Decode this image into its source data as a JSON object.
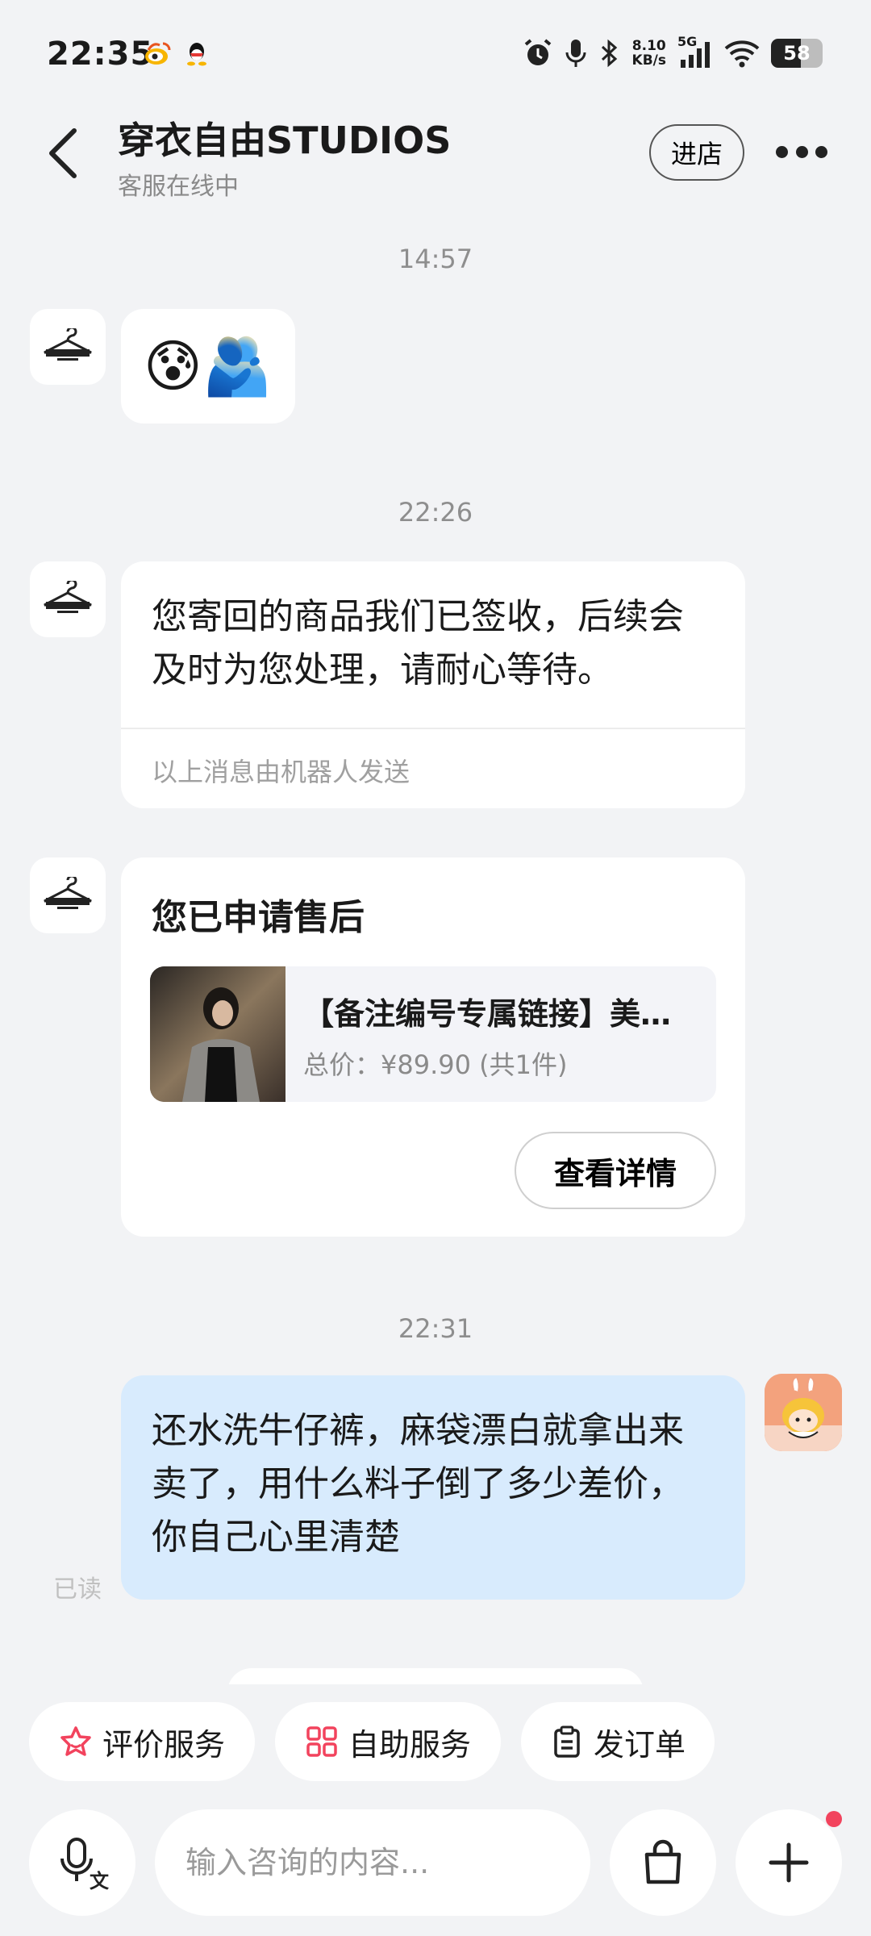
{
  "status_bar": {
    "time": "22:35",
    "net_speed_value": "8.10",
    "net_speed_unit": "KB/s",
    "network_type": "5G",
    "battery": "58",
    "battery_level": 0.58
  },
  "header": {
    "title": "穿衣自由STUDIOS",
    "subtitle": "客服在线中",
    "enter_store": "进店"
  },
  "messages": {
    "ts1": "14:57",
    "emoji": "😰🫂",
    "ts2": "22:26",
    "received_text": "您寄回的商品我们已签收，后续会及时为您处理，请耐心等待。",
    "robot_note": "以上消息由机器人发送",
    "after_sale": {
      "title": "您已申请售后",
      "product_name": "【备注编号专属链接】美…",
      "product_price": "总价：¥89.90 (共1件)",
      "detail_button": "查看详情"
    },
    "ts3": "22:31",
    "sent_text": "还水洗牛仔裤，麻袋漂白就拿出来卖了，用什么料子倒了多少差价，你自己心里清楚",
    "read_status": "已读"
  },
  "quick_actions": {
    "rate": "评价服务",
    "self_service": "自助服务",
    "send_order": "发订单"
  },
  "input": {
    "placeholder": "输入咨询的内容..."
  },
  "colors": {
    "accent_red": "#f2435d",
    "sent_bubble": "#d8ebfd"
  }
}
